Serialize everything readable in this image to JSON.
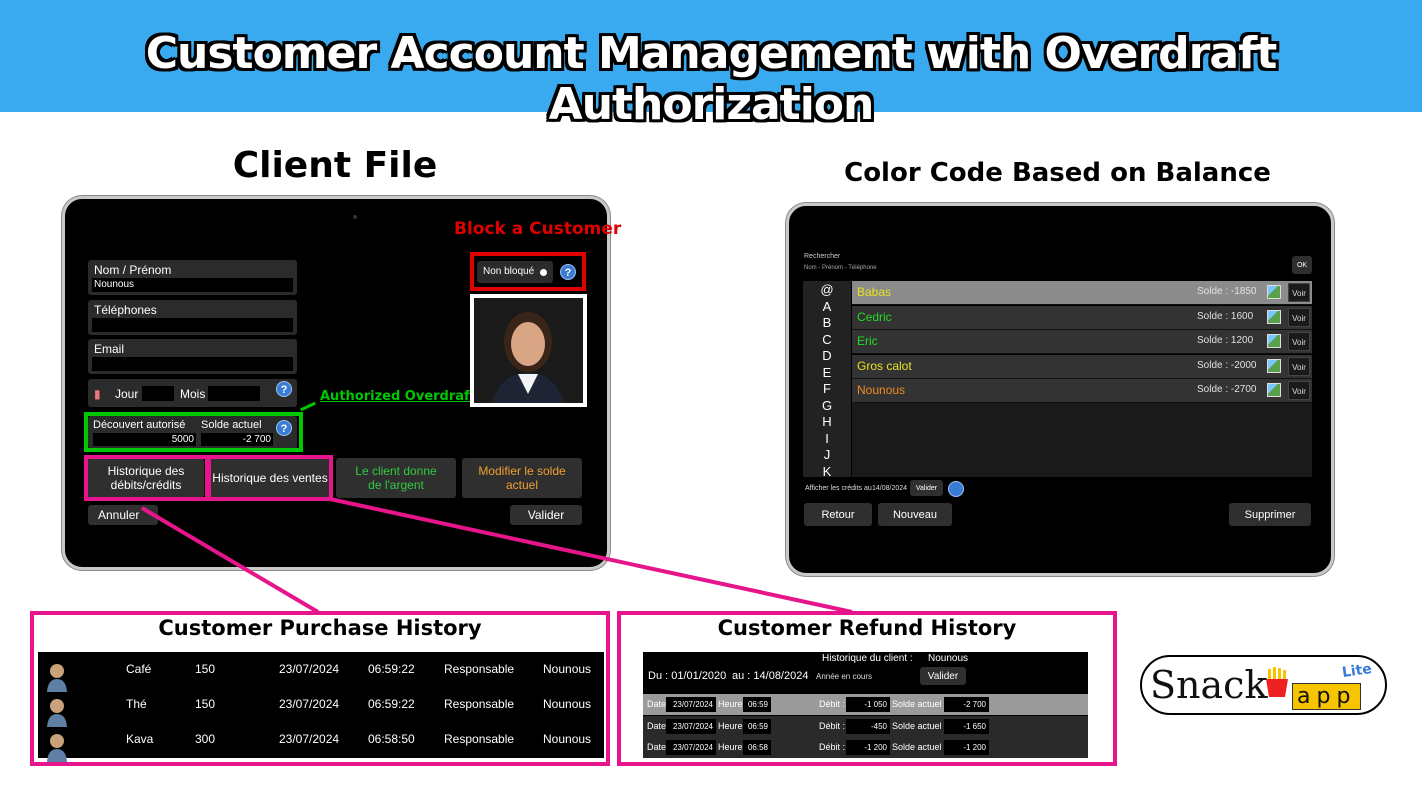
{
  "banner": {
    "title": "Customer Account Management with Overdraft Authorization"
  },
  "headings": {
    "client_file": "Client File",
    "color_code": "Color Code Based on Balance",
    "purchase_history": "Customer Purchase History",
    "refund_history": "Customer Refund History"
  },
  "callouts": {
    "block_customer": "Block a Customer",
    "authorized_overdraft": "Authorized Overdraft"
  },
  "client_file": {
    "name_label": "Nom / Prénom",
    "name_value": "Nounous",
    "phones_label": "Téléphones",
    "phones_value": "",
    "email_label": "Email",
    "email_value": "",
    "day_label": "Jour",
    "month_label": "Mois",
    "overdraft_label": "Découvert autorisé",
    "overdraft_value": "5000",
    "balance_label": "Solde actuel",
    "balance_value": "-2 700",
    "block_toggle_label": "Non bloqué",
    "help": "?",
    "btn_debits_credits": "Historique des débits/crédits",
    "btn_sales_history": "Historique des ventes",
    "btn_client_gives_money": "Le client donne de l'argent",
    "btn_modify_balance": "Modifier le solde actuel",
    "btn_cancel": "Annuler",
    "btn_validate": "Valider",
    "colors": {
      "client_gives_money": "#2ecc40",
      "modify_balance": "#f0a030"
    }
  },
  "client_list": {
    "search_label": "Rechercher",
    "search_placeholder": "Nom - Prénom - Téléphone",
    "ok_label": "OK",
    "letters": [
      "@",
      "A",
      "B",
      "C",
      "D",
      "E",
      "F",
      "G",
      "H",
      "I",
      "J",
      "K"
    ],
    "rows": [
      {
        "name": "Babas",
        "balance": "Solde : -1850",
        "color": "#e8e020",
        "view": "Voir"
      },
      {
        "name": "Cedric",
        "balance": "Solde : 1600",
        "color": "#22dd22",
        "view": "Voir"
      },
      {
        "name": "Eric",
        "balance": "Solde : 1200",
        "color": "#22dd22",
        "view": "Voir"
      },
      {
        "name": "Gros calot",
        "balance": "Solde : -2000",
        "color": "#e8e020",
        "view": "Voir"
      },
      {
        "name": "Nounous",
        "balance": "Solde : -2700",
        "color": "#f08a20",
        "view": "Voir"
      }
    ],
    "credits_label": "Afficher les crédits au",
    "credits_date": "14/08/2024",
    "credits_validate": "Valider",
    "btn_back": "Retour",
    "btn_new": "Nouveau",
    "btn_delete": "Supprimer"
  },
  "purchase_history": {
    "rows": [
      {
        "item": "Café",
        "amount": "150",
        "date": "23/07/2024",
        "time": "06:59:22",
        "role": "Responsable",
        "client": "Nounous"
      },
      {
        "item": "Thé",
        "amount": "150",
        "date": "23/07/2024",
        "time": "06:59:22",
        "role": "Responsable",
        "client": "Nounous"
      },
      {
        "item": "Kava",
        "amount": "300",
        "date": "23/07/2024",
        "time": "06:58:50",
        "role": "Responsable",
        "client": "Nounous"
      }
    ]
  },
  "refund_history": {
    "title_label": "Historique du client :",
    "title_client": "Nounous",
    "from_label": "Du : 01/01/2020",
    "to_label": "au : 14/08/2024",
    "year_select": "Année en cours",
    "validate": "Valider",
    "date_label": "Date",
    "time_label": "Heure",
    "debit_label": "Débit :",
    "balance_label": "Solde actuel :",
    "rows": [
      {
        "date": "23/07/2024",
        "time": "06:59",
        "debit": "-1 050",
        "balance": "-2 700"
      },
      {
        "date": "23/07/2024",
        "time": "06:59",
        "debit": "-450",
        "balance": "-1 650"
      },
      {
        "date": "23/07/2024",
        "time": "06:58",
        "debit": "-1 200",
        "balance": "-1 200"
      }
    ]
  },
  "logo": {
    "text_snack": "Snack",
    "text_app": "app",
    "text_lite": "Lite"
  }
}
